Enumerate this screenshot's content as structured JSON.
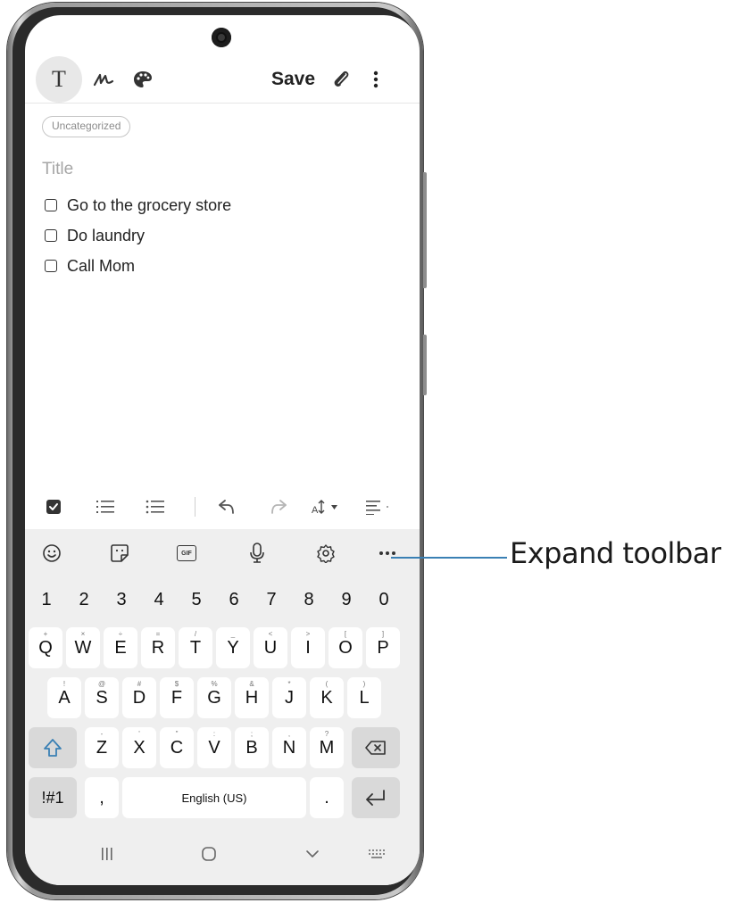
{
  "note_toolbar": {
    "text_mode_label": "T",
    "save_label": "Save"
  },
  "note": {
    "category": "Uncategorized",
    "title_placeholder": "Title",
    "checklist": [
      {
        "text": "Go to the grocery store",
        "checked": false
      },
      {
        "text": "Do laundry",
        "checked": false
      },
      {
        "text": "Call Mom",
        "checked": false
      }
    ]
  },
  "format_toolbar": {
    "icons": [
      "checkbox-icon",
      "numbered-list-icon",
      "bullet-list-icon",
      "undo-icon",
      "redo-icon",
      "text-size-icon",
      "align-icon"
    ]
  },
  "keyboard": {
    "toolbar_icons": [
      "emoji-icon",
      "sticker-icon",
      "gif-icon",
      "microphone-icon",
      "settings-icon",
      "more-icon"
    ],
    "gif_label": "GIF",
    "rows": {
      "numbers": [
        "1",
        "2",
        "3",
        "4",
        "5",
        "6",
        "7",
        "8",
        "9",
        "0"
      ],
      "row1": [
        "Q",
        "W",
        "E",
        "R",
        "T",
        "Y",
        "U",
        "I",
        "O",
        "P"
      ],
      "row1_hints": [
        "+",
        "×",
        "÷",
        "=",
        "/",
        "_",
        "<",
        ">",
        "[",
        "]"
      ],
      "row2": [
        "A",
        "S",
        "D",
        "F",
        "G",
        "H",
        "J",
        "K",
        "L"
      ],
      "row2_hints": [
        "!",
        "@",
        "#",
        "$",
        "%",
        "&",
        "*",
        "(",
        ")"
      ],
      "row3": [
        "Z",
        "X",
        "C",
        "V",
        "B",
        "N",
        "M"
      ],
      "row3_hints": [
        "-",
        "'",
        "\"",
        ":",
        ";",
        ",",
        "?"
      ]
    },
    "symbols_label": "!#1",
    "comma_label": ",",
    "space_label": "English (US)",
    "period_label": "."
  },
  "navigation": {
    "icons": [
      "recent-apps-icon",
      "home-icon",
      "back-icon",
      "keyboard-switch-icon"
    ]
  },
  "annotation": {
    "label": "Expand toolbar"
  },
  "colors": {
    "accent_blue": "#3a80b4",
    "keyboard_bg": "#efefef",
    "key_bg": "#ffffff",
    "special_key_bg": "#d9d9d9"
  }
}
